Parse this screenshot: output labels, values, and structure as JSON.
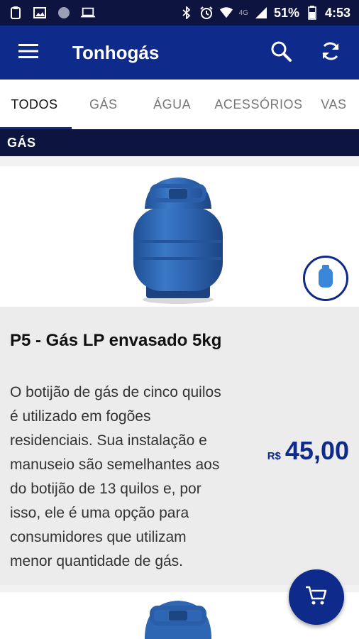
{
  "status_bar": {
    "network": "4G",
    "battery": "51%",
    "time": "4:53"
  },
  "app": {
    "title": "Tonhogás"
  },
  "tabs": [
    {
      "label": "TODOS",
      "active": true
    },
    {
      "label": "GÁS",
      "active": false
    },
    {
      "label": "ÁGUA",
      "active": false
    },
    {
      "label": "ACESSÓRIOS",
      "active": false
    },
    {
      "label": "VAS",
      "active": false
    }
  ],
  "section": {
    "title": "GÁS"
  },
  "products": [
    {
      "title": "P5 - Gás LP envasado 5kg",
      "description": "O botijão de gás de cinco quilos é utilizado em fogões residenciais. Sua instalação e manuseio são semelhantes aos do botijão de 13 quilos e, por isso, ele é uma opção para consumidores que utilizam menor quantidade de gás.",
      "currency": "R$",
      "price": "45,00"
    }
  ],
  "colors": {
    "primary": "#0e2a8a",
    "dark": "#0d1440",
    "cylinder": "#2f66b3"
  }
}
